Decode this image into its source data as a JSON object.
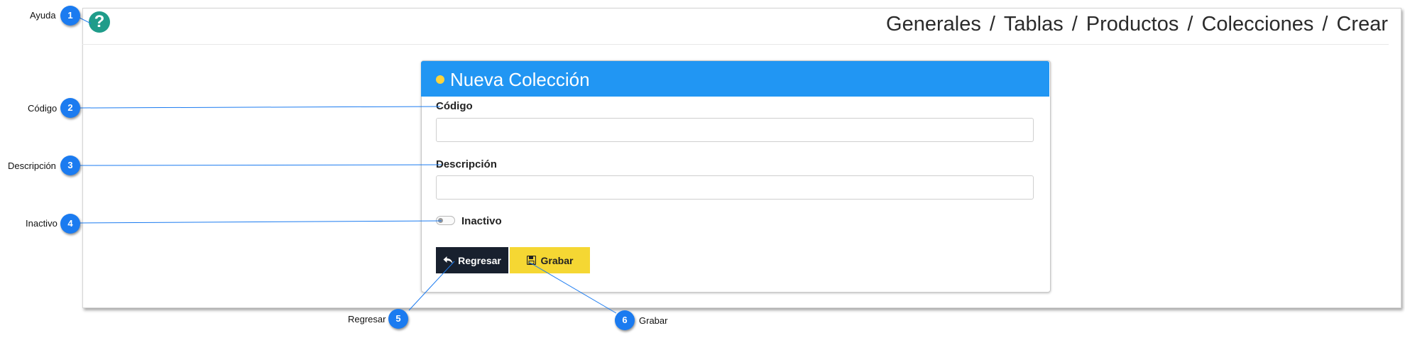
{
  "header": {
    "breadcrumb": [
      "Generales",
      "Tablas",
      "Productos",
      "Colecciones",
      "Crear"
    ],
    "breadcrumb_separator": "/",
    "help_icon": "question-circle-icon"
  },
  "card": {
    "title": "Nueva Colección",
    "header_color": "#2196f3",
    "dot_color": "#ffd43b"
  },
  "form": {
    "codigo_label": "Código",
    "codigo_value": "",
    "descripcion_label": "Descripción",
    "descripcion_value": "",
    "inactivo_label": "Inactivo",
    "inactivo_checked": false
  },
  "buttons": {
    "regresar_label": "Regresar",
    "regresar_icon": "reply-arrow-icon",
    "regresar_color": "#18202e",
    "grabar_label": "Grabar",
    "grabar_icon": "floppy-disk-icon",
    "grabar_color": "#f5d733"
  },
  "callouts": [
    {
      "number": "1",
      "label": "Ayuda"
    },
    {
      "number": "2",
      "label": "Código"
    },
    {
      "number": "3",
      "label": "Descripción"
    },
    {
      "number": "4",
      "label": "Inactivo"
    },
    {
      "number": "5",
      "label": "Regresar"
    },
    {
      "number": "6",
      "label": "Grabar"
    }
  ]
}
